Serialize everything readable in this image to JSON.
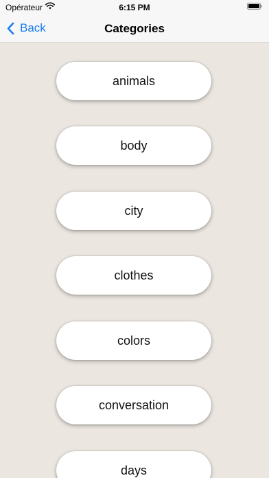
{
  "status_bar": {
    "carrier": "Opérateur",
    "time": "6:15 PM"
  },
  "nav": {
    "back_label": "Back",
    "title": "Categories"
  },
  "categories": [
    "animals",
    "body",
    "city",
    "clothes",
    "colors",
    "conversation",
    "days"
  ],
  "colors": {
    "accent": "#1a7cf0",
    "background": "#ebe6e0",
    "button": "#ffffff"
  }
}
